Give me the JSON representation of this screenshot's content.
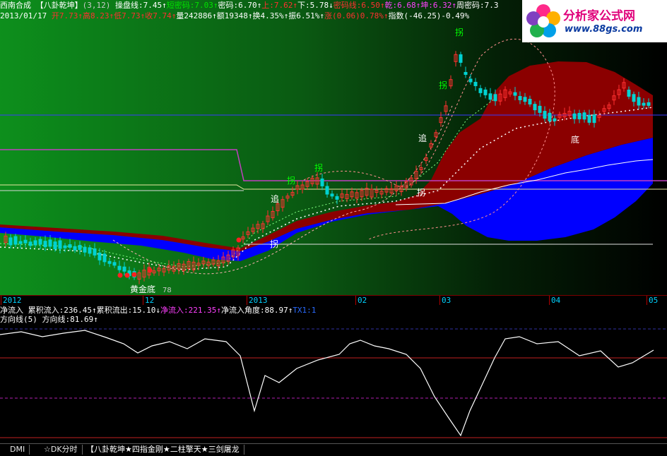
{
  "header": {
    "line1": [
      {
        "text": "西南合成 ",
        "color": "#ffffff"
      },
      {
        "text": "【八卦乾坤】",
        "color": "#ffffff"
      },
      {
        "text": "(3,12) ",
        "color": "#c8c8c8"
      },
      {
        "text": "操盘线:7.45↑",
        "color": "#ffffff"
      },
      {
        "text": "短密码:7.03↑",
        "color": "#00e000"
      },
      {
        "text": "密码:6.70↑",
        "color": "#ffffff"
      },
      {
        "text": "上:7.62↑",
        "color": "#ff3030"
      },
      {
        "text": "下:5.78↓",
        "color": "#ffffff"
      },
      {
        "text": "密码线:6.50↑",
        "color": "#ff3030"
      },
      {
        "text": "乾:6.68↑",
        "color": "#ff40ff"
      },
      {
        "text": "坤:6.32↑",
        "color": "#ff40ff"
      },
      {
        "text": "周密码:7.3",
        "color": "#ffffff"
      }
    ],
    "line2": [
      {
        "text": "2013/01/17 ",
        "color": "#ffffff"
      },
      {
        "text": "开7.73↑",
        "color": "#ff3030"
      },
      {
        "text": "高8.23↑",
        "color": "#ff3030"
      },
      {
        "text": "低7.73↑",
        "color": "#ff3030"
      },
      {
        "text": "收7.74↑",
        "color": "#ff3030"
      },
      {
        "text": "量242886↑",
        "color": "#ffffff"
      },
      {
        "text": "额19348↑",
        "color": "#ffffff"
      },
      {
        "text": "换4.35%↑",
        "color": "#ffffff"
      },
      {
        "text": "振6.51%↑",
        "color": "#ffffff"
      },
      {
        "text": "涨(0.06)0.78%↑",
        "color": "#ff3030"
      },
      {
        "text": "指数(-46.25)-0.49%",
        "color": "#ffffff"
      }
    ]
  },
  "logo": {
    "brand": "分析家公式网",
    "url": "www.88gs.com"
  },
  "annotations": [
    {
      "text": "拐",
      "color": "#00ff00"
    },
    {
      "text": "拐",
      "color": "#00ff00"
    },
    {
      "text": "拐",
      "color": "#00ff00"
    },
    {
      "text": "拐",
      "color": "#00ff00"
    },
    {
      "text": "追",
      "color": "#ffffff"
    },
    {
      "text": "追",
      "color": "#ffffff"
    },
    {
      "text": "拐",
      "color": "#ffffff"
    },
    {
      "text": "拐",
      "color": "#ffffff"
    },
    {
      "text": "底",
      "color": "#ffffff"
    },
    {
      "text": "黄金底",
      "color": "#ffffff"
    },
    {
      "text": "78",
      "color": "#c8c8c8"
    }
  ],
  "time_axis": [
    "2012",
    "12",
    "2013",
    "02",
    "03",
    "04",
    "05"
  ],
  "indicator": {
    "line1": [
      {
        "text": "净流入 ",
        "color": "#ffffff"
      },
      {
        "text": "累积流入:236.45↑",
        "color": "#ffffff"
      },
      {
        "text": "累积流出:15.10↓",
        "color": "#ffffff"
      },
      {
        "text": "净流入:221.35↑",
        "color": "#ff40ff"
      },
      {
        "text": "净流入角度:88.97↑",
        "color": "#ffffff"
      },
      {
        "text": "TX1:1",
        "color": "#2a6bff"
      }
    ],
    "line2": [
      {
        "text": "方向线(5) ",
        "color": "#ffffff"
      },
      {
        "text": "方向线:81.69↑",
        "color": "#ffffff"
      }
    ]
  },
  "tabs": [
    "DMI",
    "☆DK分时",
    "【八卦乾坤★四指金刚★二柱擎天★三剑屠龙"
  ],
  "colors": {
    "up": "#ff3030",
    "down": "#00d2d2",
    "band_red": "#8b0000",
    "band_blue": "#0000ff",
    "bg_green": "#0f8a1a"
  }
}
